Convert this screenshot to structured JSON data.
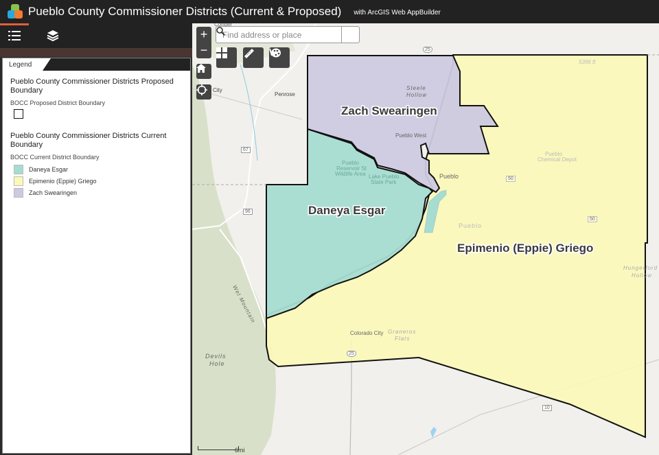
{
  "header": {
    "title": "Pueblo County Commissioner Districts (Current & Proposed)",
    "subtitle": "with ArcGIS Web AppBuilder"
  },
  "panel": {
    "tabs": [
      {
        "icon": "legend-list-icon",
        "active": true
      },
      {
        "icon": "layers-icon",
        "active": false
      }
    ],
    "legend": {
      "tab_label": "Legend",
      "proposed": {
        "layer_title": "Pueblo County Commissioner Districts Proposed Boundary",
        "sub_title": "BOCC Proposed District Boundary"
      },
      "current": {
        "layer_title": "Pueblo County Commissioner Districts Current Boundary",
        "sub_title": "BOCC Current District Boundary",
        "items": [
          {
            "label": "Daneya Esgar",
            "color": "#a6dcd2"
          },
          {
            "label": "Epimenio (Eppie) Griego",
            "color": "#fbf8b8"
          },
          {
            "label": "Zach Swearingen",
            "color": "#cdc9e0"
          }
        ]
      }
    }
  },
  "map": {
    "search_placeholder": "Find address or place",
    "zoom_in": "+",
    "zoom_out": "−",
    "tools": [
      "basemap-gallery-icon",
      "measure-icon",
      "draw-palette-icon"
    ],
    "districts": [
      {
        "name": "Zach Swearingen",
        "color": "#cdc9e0"
      },
      {
        "name": "Daneya Esgar",
        "color": "#a6dcd2"
      },
      {
        "name": "Epimenio (Eppie) Griego",
        "color": "#fbf8b8"
      }
    ],
    "place_labels": {
      "penrose": "Penrose",
      "city": "City",
      "steele_hollow_1": "Steele",
      "steele_hollow_2": "Hollow",
      "pueblo_west": "Pueblo West",
      "pueblo": "Pueblo",
      "pueblo_2": "Pueblo",
      "reservoir_1": "Pueblo",
      "reservoir_2": "Reservoir St",
      "reservoir_3": "Wildlife Area",
      "lake_1": "Lake Pueblo",
      "lake_2": "State Park",
      "chem_1": "Pueblo",
      "chem_2": "Chemical Depot",
      "elev": "5396 ft",
      "colorado_city": "Colorado City",
      "graneros_1": "Graneros",
      "graneros_2": "Flats",
      "devils_1": "Devils",
      "devils_2": "Hole",
      "hunger_1": "Hungerford",
      "hunger_2": "Hollow",
      "wet_mountain": "Wet Mountain",
      "canon": "Conder"
    },
    "road_shields": {
      "i25_top": "25",
      "i25_bottom": "25",
      "us50_a": "50",
      "us50_b": "50",
      "sh67": "67",
      "sh96": "96",
      "sh10": "10"
    },
    "scale_label": "6mi"
  }
}
